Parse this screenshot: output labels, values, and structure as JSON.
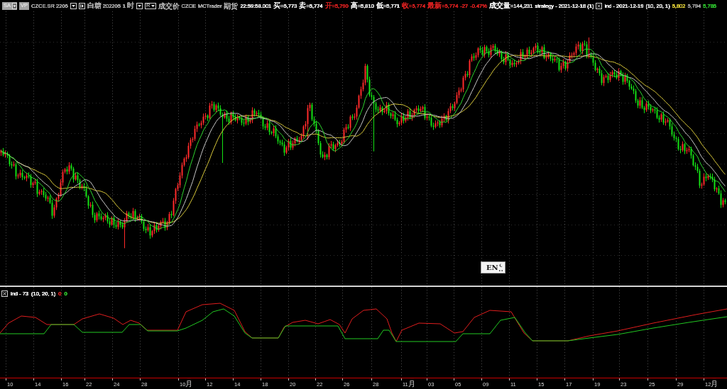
{
  "toolbar": {
    "items": [
      {
        "kind": "menu",
        "label": "SA"
      },
      {
        "kind": "button",
        "label": "VP"
      },
      {
        "kind": "text",
        "text": "CZCE.SR 2205",
        "color": "#a8a8a8"
      },
      {
        "kind": "dropdown"
      },
      {
        "kind": "step"
      },
      {
        "kind": "text",
        "text": "白糖 202205",
        "color": "#a8a8a8"
      },
      {
        "kind": "text",
        "text": "1 时",
        "color": "#a8a8a8"
      },
      {
        "kind": "dropdown"
      },
      {
        "kind": "picker",
        "label": "R"
      },
      {
        "kind": "text",
        "text": "成交价",
        "color": "#a8a8a8"
      },
      {
        "kind": "text",
        "text": "CZCE",
        "color": "#a8a8a8"
      },
      {
        "kind": "text",
        "text": "MCTrader",
        "color": "#a8a8a8"
      },
      {
        "kind": "text",
        "text": "期货",
        "color": "#a8a8a8"
      },
      {
        "kind": "text",
        "text": "22:59:58.001",
        "color": "#e8e8e8"
      },
      {
        "kind": "text",
        "text": "买=5,773",
        "color": "#e8e8e8"
      },
      {
        "kind": "text",
        "text": "卖=5,774",
        "color": "#e8e8e8"
      },
      {
        "kind": "text",
        "text": "开=5,790",
        "color": "#d42020"
      },
      {
        "kind": "text",
        "text": "高=5,810",
        "color": "#e8e8e8"
      },
      {
        "kind": "text",
        "text": "低=5,771",
        "color": "#e8e8e8"
      },
      {
        "kind": "text",
        "text": "收=5,774",
        "color": "#d42020"
      },
      {
        "kind": "text",
        "text": "最新=5,774",
        "color": "#d42020"
      },
      {
        "kind": "text",
        "text": "-27",
        "color": "#d42020"
      },
      {
        "kind": "text",
        "text": "-0.47%",
        "color": "#d42020"
      },
      {
        "kind": "text",
        "text": "成交量=144,231",
        "color": "#e8e8e8"
      },
      {
        "kind": "text",
        "text": "strategy - 2021-12-18 (1)",
        "color": "#e8e8e8"
      },
      {
        "kind": "close"
      },
      {
        "kind": "text",
        "text": "ind - 2021-12-19",
        "color": "#e8e8e8"
      },
      {
        "kind": "text",
        "text": "(10, 20, 1)",
        "color": "#e8e8e8"
      },
      {
        "kind": "text",
        "text": "5,802",
        "color": "#d8c838"
      },
      {
        "kind": "text",
        "text": "5,794",
        "color": "#a0a0a0"
      },
      {
        "kind": "text",
        "text": "5,786",
        "color": "#30c830"
      }
    ]
  },
  "ime_indicator": {
    "label": "EN"
  },
  "indicator_panel": {
    "header": [
      {
        "kind": "close"
      },
      {
        "kind": "text",
        "text": "ind - 73",
        "color": "#e8e8e8"
      },
      {
        "kind": "text",
        "text": "(10, 20, 1)",
        "color": "#e8e8e8"
      },
      {
        "kind": "text",
        "text": "0",
        "color": "#d42020"
      },
      {
        "kind": "text",
        "text": "0",
        "color": "#30c830"
      }
    ]
  },
  "x_axis": {
    "labels": [
      "10",
      "14",
      "16",
      "22",
      "24",
      "28",
      "10月",
      "12",
      "14",
      "18",
      "20",
      "22",
      "26",
      "28",
      "11月",
      "03",
      "05",
      "09",
      "11",
      "15",
      "17",
      "19",
      "23",
      "25",
      "29",
      "12月"
    ]
  }
}
